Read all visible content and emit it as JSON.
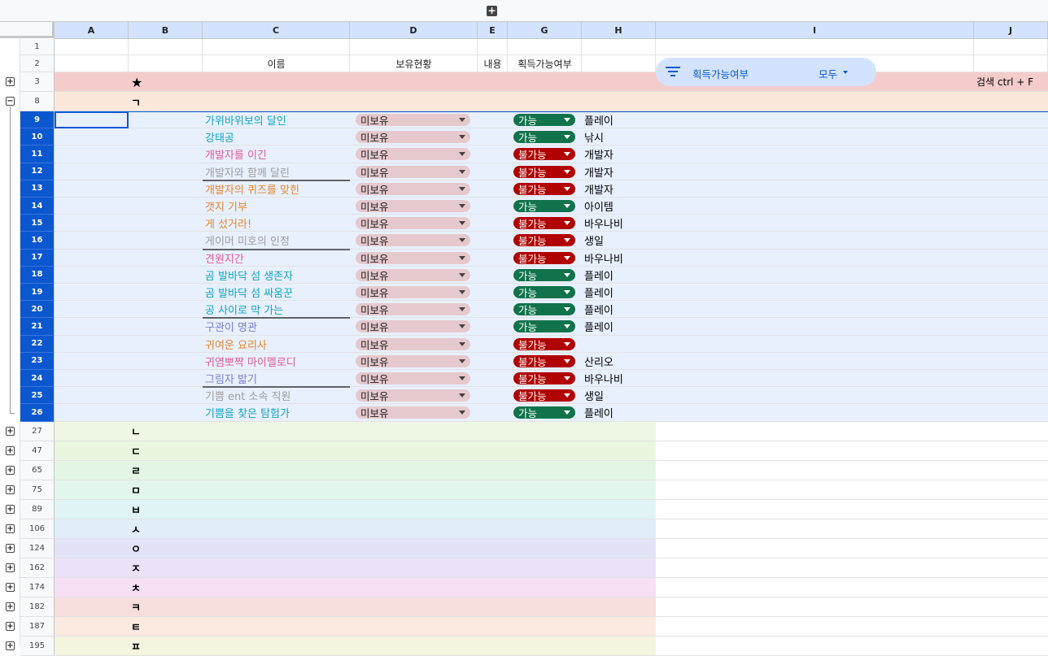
{
  "top_group_icon": "+",
  "columns": [
    "A",
    "B",
    "C",
    "D",
    "E",
    "G",
    "H",
    "I",
    "J"
  ],
  "headers": {
    "name": "이름",
    "owned": "보유현황",
    "content": "내용",
    "obtainable": "획득가능여부"
  },
  "filter": {
    "icon": "filter-icon",
    "label": "획득가능여부",
    "value": "모두"
  },
  "search_hint": "검색 ctrl + F",
  "special_rows": [
    {
      "num": "1"
    },
    {
      "num": "2"
    },
    {
      "num": "3",
      "group": "★",
      "color": "#f4cccc"
    },
    {
      "num": "8",
      "group": "ㄱ",
      "color": "#fce8db"
    }
  ],
  "rows": [
    {
      "num": "9",
      "name": "가위바위보의 달인",
      "name_color": "#12a4c2",
      "owned": "미보유",
      "obtain": "가능",
      "content": "플레이"
    },
    {
      "num": "10",
      "name": "강태공",
      "name_color": "#12a4c2",
      "owned": "미보유",
      "obtain": "가능",
      "content": "낚시"
    },
    {
      "num": "11",
      "name": "개발자를 이긴",
      "name_color": "#e05a9b",
      "owned": "미보유",
      "obtain": "불가능",
      "content": "개발자"
    },
    {
      "num": "12",
      "name": "개발자와 함께 달린",
      "name_color": "#9e9e9e",
      "owned": "미보유",
      "obtain": "불가능",
      "content": "개발자"
    },
    {
      "num": "13",
      "name": "개발자의 퀴즈를 맞힌",
      "name_color": "#e8862b",
      "owned": "미보유",
      "obtain": "불가능",
      "content": "개발자"
    },
    {
      "num": "14",
      "name": "갯지 기부",
      "name_color": "#e8862b",
      "owned": "미보유",
      "obtain": "가능",
      "content": "아이템"
    },
    {
      "num": "15",
      "name": "게 섰거라!",
      "name_color": "#e8862b",
      "owned": "미보유",
      "obtain": "불가능",
      "content": "바우나비"
    },
    {
      "num": "16",
      "name": "게이머 미호의 인정",
      "name_color": "#9e9e9e",
      "owned": "미보유",
      "obtain": "불가능",
      "content": "생일"
    },
    {
      "num": "17",
      "name": "견원지간",
      "name_color": "#e05a9b",
      "owned": "미보유",
      "obtain": "불가능",
      "content": "바우나비"
    },
    {
      "num": "18",
      "name": "곰 발바닥 섬 생존자",
      "name_color": "#12a4c2",
      "owned": "미보유",
      "obtain": "가능",
      "content": "플레이"
    },
    {
      "num": "19",
      "name": "곰 발바닥 섬 싸움꾼",
      "name_color": "#12a4c2",
      "owned": "미보유",
      "obtain": "가능",
      "content": "플레이"
    },
    {
      "num": "20",
      "name": "공 사이로 막 가는",
      "name_color": "#12a4c2",
      "owned": "미보유",
      "obtain": "가능",
      "content": "플레이"
    },
    {
      "num": "21",
      "name": "구관이 명관",
      "name_color": "#7b7fd0",
      "owned": "미보유",
      "obtain": "가능",
      "content": "플레이"
    },
    {
      "num": "22",
      "name": "귀여운 요리사",
      "name_color": "#e8862b",
      "owned": "미보유",
      "obtain": "불가능",
      "content": ""
    },
    {
      "num": "23",
      "name": "귀염뽀짝 마이멜로디",
      "name_color": "#e05a9b",
      "owned": "미보유",
      "obtain": "불가능",
      "content": "산리오"
    },
    {
      "num": "24",
      "name": "그림자 밟기",
      "name_color": "#7b7fd0",
      "owned": "미보유",
      "obtain": "불가능",
      "content": "바우나비"
    },
    {
      "num": "25",
      "name": "기쁨 ent 소속 직원",
      "name_color": "#9e9e9e",
      "owned": "미보유",
      "obtain": "불가능",
      "content": "생일"
    },
    {
      "num": "26",
      "name": "기쁨을 찾은 탐험가",
      "name_color": "#12a4c2",
      "owned": "미보유",
      "obtain": "가능",
      "content": "플레이"
    }
  ],
  "groups": [
    {
      "num": "27",
      "letter": "ㄴ",
      "color": "#eef7e3"
    },
    {
      "num": "47",
      "letter": "ㄷ",
      "color": "#eaf6df"
    },
    {
      "num": "65",
      "letter": "ㄹ",
      "color": "#e3f5e3"
    },
    {
      "num": "75",
      "letter": "ㅁ",
      "color": "#e2f6ec"
    },
    {
      "num": "89",
      "letter": "ㅂ",
      "color": "#e0f4f5"
    },
    {
      "num": "106",
      "letter": "ㅅ",
      "color": "#e1edf8"
    },
    {
      "num": "124",
      "letter": "ㅇ",
      "color": "#e3e3f7"
    },
    {
      "num": "162",
      "letter": "ㅈ",
      "color": "#ece2f7"
    },
    {
      "num": "174",
      "letter": "ㅊ",
      "color": "#f6e0f4"
    },
    {
      "num": "182",
      "letter": "ㅋ",
      "color": "#f8dedd"
    },
    {
      "num": "187",
      "letter": "ㅌ",
      "color": "#faeae0"
    },
    {
      "num": "195",
      "letter": "ㅍ",
      "color": "#f4f4df"
    }
  ],
  "colors": {
    "selected_band": "#e8f0fe",
    "chip_owned": "#e6c9cd",
    "chip_yes": "#11734b",
    "chip_no": "#b10202",
    "accent": "#0b57d0"
  }
}
